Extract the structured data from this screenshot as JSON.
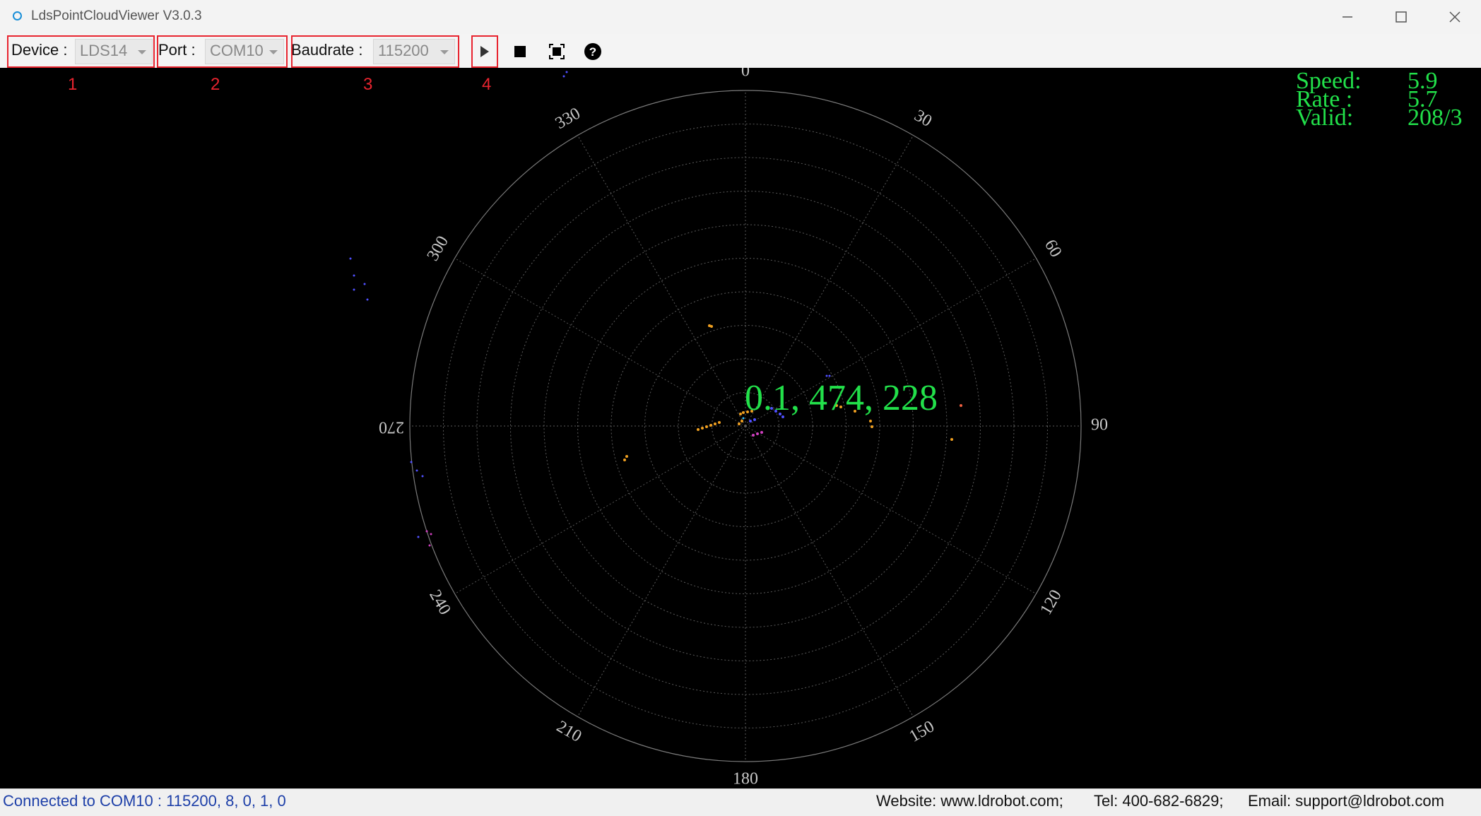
{
  "window": {
    "title": "LdsPointCloudViewer V3.0.3"
  },
  "toolbar": {
    "device_label": "Device :",
    "device_value": "LDS14",
    "port_label": "Port :",
    "port_value": "COM10",
    "baudrate_label": "Baudrate :",
    "baudrate_value": "115200",
    "buttons": [
      "play-icon",
      "stop-icon",
      "fit-view-icon",
      "help-icon"
    ]
  },
  "annotations": [
    "1",
    "2",
    "3",
    "4"
  ],
  "plot": {
    "angle_labels": [
      "0",
      "30",
      "60",
      "90",
      "120",
      "150",
      "180",
      "210",
      "240",
      "270",
      "300",
      "330"
    ],
    "cursor_readout": "0.1, 474, 228",
    "metrics": [
      {
        "label": "Speed:",
        "value": "5.9"
      },
      {
        "label": "Rate :",
        "value": "5.7"
      },
      {
        "label": "Valid:",
        "value": "208/3"
      }
    ],
    "colors": {
      "grid": "#7a7a7a",
      "points_orange": "#f0a020",
      "points_blue": "#5050ff",
      "points_magenta": "#d040c0",
      "readout": "#22e04a"
    }
  },
  "status": {
    "connection": "Connected to COM10 : 115200, 8, 0, 1, 0",
    "website": "Website: www.ldrobot.com;",
    "tel": "Tel: 400-682-6829;",
    "email": "Email: support@ldrobot.com"
  }
}
